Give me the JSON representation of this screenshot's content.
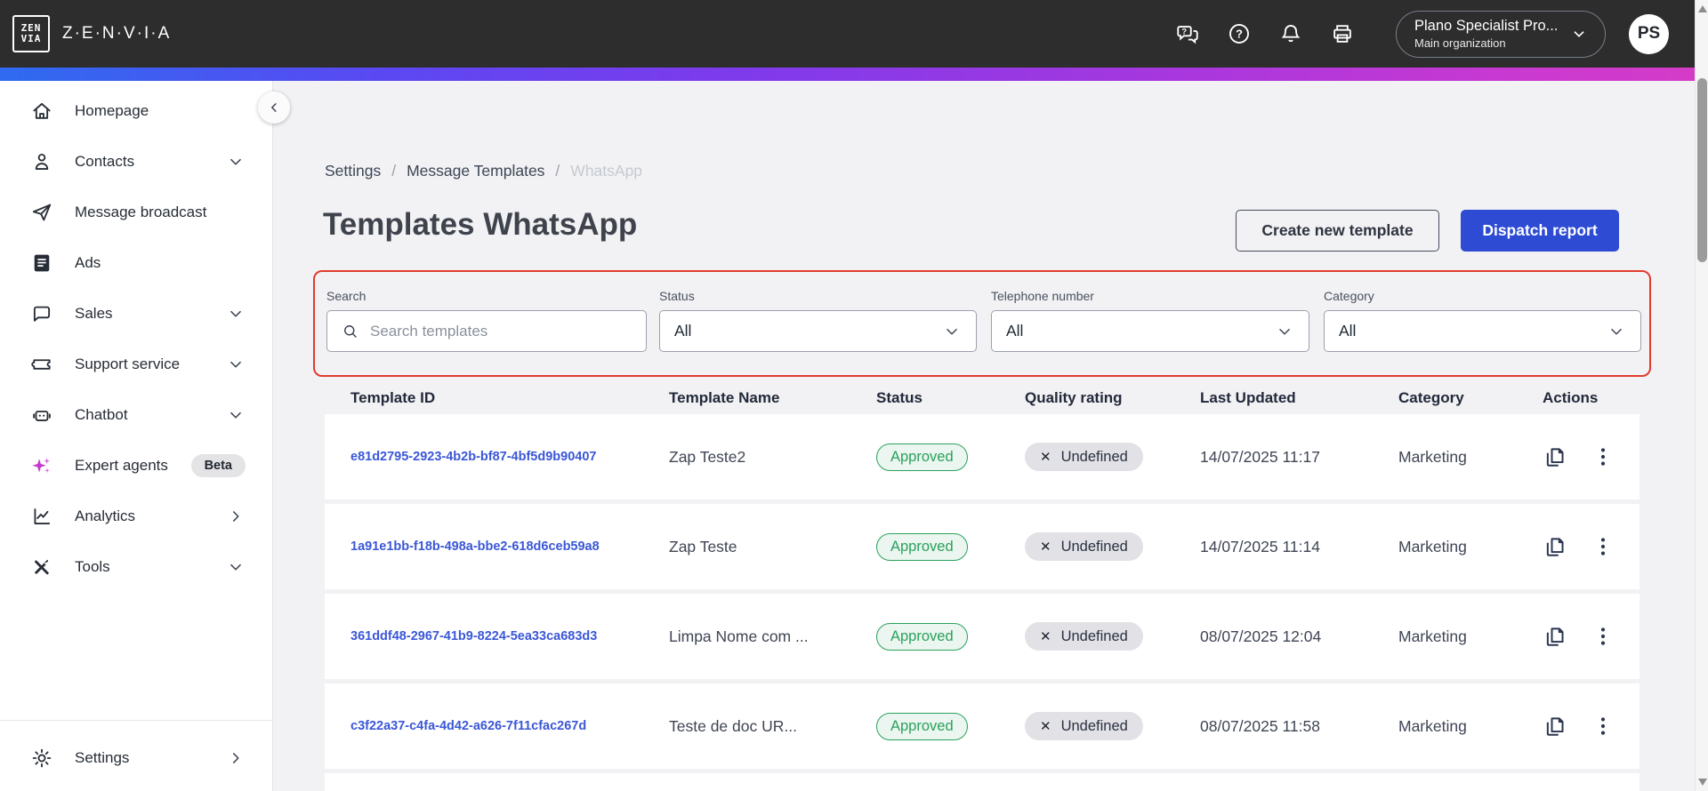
{
  "topbar": {
    "brand": "Z·E·N·V·I·A",
    "logo_line1": "ZEN",
    "logo_line2": "VIA",
    "org": {
      "name": "Plano Specialist Pro...",
      "sub": "Main organization"
    },
    "avatar_initials": "PS"
  },
  "sidebar": {
    "items": [
      {
        "label": "Homepage"
      },
      {
        "label": "Contacts"
      },
      {
        "label": "Message broadcast"
      },
      {
        "label": "Ads"
      },
      {
        "label": "Sales"
      },
      {
        "label": "Support service"
      },
      {
        "label": "Chatbot"
      },
      {
        "label": "Expert agents",
        "badge": "Beta"
      },
      {
        "label": "Analytics"
      },
      {
        "label": "Tools"
      }
    ],
    "settings_label": "Settings"
  },
  "breadcrumb": {
    "0": "Settings",
    "1": "Message Templates",
    "2": "WhatsApp",
    "sep": "/"
  },
  "page": {
    "title": "Templates WhatsApp"
  },
  "actions": {
    "create_label": "Create new template",
    "dispatch_label": "Dispatch report"
  },
  "filters": {
    "search": {
      "label": "Search",
      "placeholder": "Search templates"
    },
    "status": {
      "label": "Status",
      "value": "All"
    },
    "telephone": {
      "label": "Telephone number",
      "value": "All"
    },
    "category": {
      "label": "Category",
      "value": "All"
    }
  },
  "table": {
    "headers": [
      "Template ID",
      "Template Name",
      "Status",
      "Quality rating",
      "Last Updated",
      "Category",
      "Actions"
    ],
    "rows": [
      {
        "id": "e81d2795-2923-4b2b-bf87-4bf5d9b90407",
        "name": "Zap Teste2",
        "status": "Approved",
        "quality": "Undefined",
        "updated": "14/07/2025 11:17",
        "category": "Marketing"
      },
      {
        "id": "1a91e1bb-f18b-498a-bbe2-618d6ceb59a8",
        "name": "Zap Teste",
        "status": "Approved",
        "quality": "Undefined",
        "updated": "14/07/2025 11:14",
        "category": "Marketing"
      },
      {
        "id": "361ddf48-2967-41b9-8224-5ea33ca683d3",
        "name": "Limpa Nome com ...",
        "status": "Approved",
        "quality": "Undefined",
        "updated": "08/07/2025 12:04",
        "category": "Marketing"
      },
      {
        "id": "c3f22a37-c4fa-4d42-a626-7f11cfac267d",
        "name": "Teste de doc UR...",
        "status": "Approved",
        "quality": "Undefined",
        "updated": "08/07/2025 11:58",
        "category": "Marketing"
      }
    ]
  },
  "icons": {
    "x_mark": "✕"
  },
  "colors": {
    "topbar_bg": "#2d2d2d",
    "primary_button_blue": "#2d4bd3",
    "link_blue": "#3a57d7",
    "approved_green": "#2aa15c",
    "highlight_red": "#e23b2e",
    "expert_agents_pink": "#c438cc",
    "gradient": [
      "#2e6bf0",
      "#7c3bec",
      "#d53cc7"
    ]
  }
}
